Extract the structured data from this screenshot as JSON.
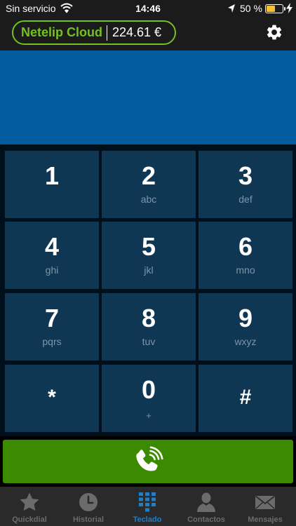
{
  "status_bar": {
    "carrier": "Sin servicio",
    "time": "14:46",
    "battery_percent": "50 %",
    "battery_level": 0.5
  },
  "header": {
    "account_name": "Netelip Cloud",
    "balance": "224.61 €"
  },
  "keypad": {
    "keys": [
      {
        "digit": "1",
        "letters": ""
      },
      {
        "digit": "2",
        "letters": "abc"
      },
      {
        "digit": "3",
        "letters": "def"
      },
      {
        "digit": "4",
        "letters": "ghi"
      },
      {
        "digit": "5",
        "letters": "jkl"
      },
      {
        "digit": "6",
        "letters": "mno"
      },
      {
        "digit": "7",
        "letters": "pqrs"
      },
      {
        "digit": "8",
        "letters": "tuv"
      },
      {
        "digit": "9",
        "letters": "wxyz"
      },
      {
        "digit": "*",
        "letters": ""
      },
      {
        "digit": "0",
        "letters": "+"
      },
      {
        "digit": "#",
        "letters": ""
      }
    ]
  },
  "tabs": [
    {
      "label": "Quickdial",
      "icon": "star-icon"
    },
    {
      "label": "Historial",
      "icon": "clock-icon"
    },
    {
      "label": "Teclado",
      "icon": "keypad-icon",
      "active": true
    },
    {
      "label": "Contactos",
      "icon": "person-icon"
    },
    {
      "label": "Mensajes",
      "icon": "envelope-icon"
    }
  ],
  "colors": {
    "brand_green": "#74c21f",
    "display_blue": "#025b9d",
    "key_background": "#0f3653",
    "call_green": "#3b8a00",
    "active_tab": "#1d7fc7"
  }
}
